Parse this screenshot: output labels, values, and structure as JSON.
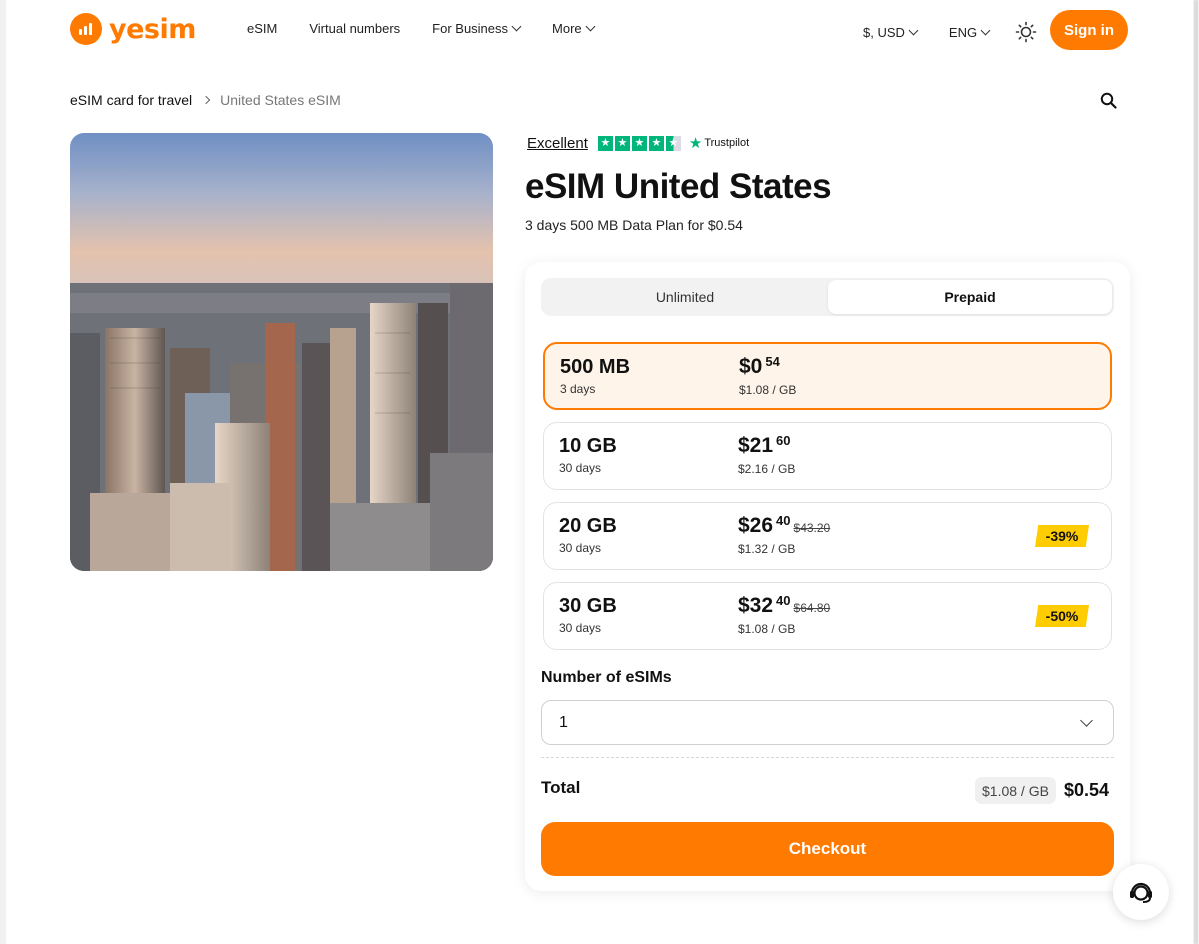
{
  "header": {
    "logo_text": "yesim",
    "nav": [
      "eSIM",
      "Virtual numbers",
      "For Business",
      "More"
    ],
    "currency": "$, USD",
    "language": "ENG",
    "signin_label": "Sign in"
  },
  "breadcrumb": {
    "parent": "eSIM card for travel",
    "current": "United States eSIM"
  },
  "product": {
    "rating_text": "Excellent",
    "rating_brand": "Trustpilot",
    "title": "eSIM United States",
    "subtitle": "3 days 500 MB Data Plan for $0.54"
  },
  "tabs": {
    "unlimited": "Unlimited",
    "prepaid": "Prepaid",
    "active": "Prepaid"
  },
  "plans": [
    {
      "volume": "500 MB",
      "days": "3 days",
      "price_int": "$0",
      "price_dec": "54",
      "old_price": "",
      "per_gb": "$1.08 / GB",
      "discount": "",
      "selected": true
    },
    {
      "volume": "10 GB",
      "days": "30 days",
      "price_int": "$21",
      "price_dec": "60",
      "old_price": "",
      "per_gb": "$2.16 / GB",
      "discount": "",
      "selected": false
    },
    {
      "volume": "20 GB",
      "days": "30 days",
      "price_int": "$26",
      "price_dec": "40",
      "old_price": "$43.20",
      "per_gb": "$1.32 / GB",
      "discount": "-39%",
      "selected": false
    },
    {
      "volume": "30 GB",
      "days": "30 days",
      "price_int": "$32",
      "price_dec": "40",
      "old_price": "$64.80",
      "per_gb": "$1.08 / GB",
      "discount": "-50%",
      "selected": false
    }
  ],
  "quantity": {
    "label": "Number of eSIMs",
    "value": "1"
  },
  "total": {
    "label": "Total",
    "per_gb": "$1.08 / GB",
    "price": "$0.54"
  },
  "checkout_label": "Checkout",
  "colors": {
    "accent": "#ff7a00",
    "selected_bg": "#fff4ea",
    "discount": "#ffcc00",
    "trustpilot": "#00b67a"
  },
  "icons": [
    "yesim-logo-icon",
    "chevron-down-icon",
    "sun-icon",
    "chevron-right-icon",
    "search-icon",
    "trustpilot-star-icon",
    "support-agent-icon"
  ]
}
